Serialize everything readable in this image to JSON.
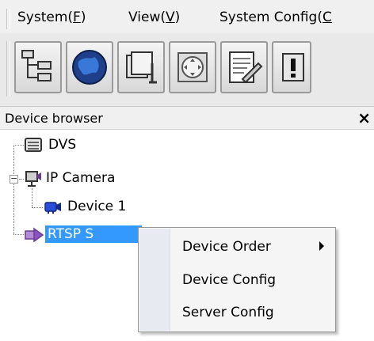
{
  "menubar": {
    "items": [
      {
        "label": "System(",
        "mnemonic": "F",
        "suffix": ")"
      },
      {
        "label": "View(",
        "mnemonic": "V",
        "suffix": ")"
      },
      {
        "label": "System Config(",
        "mnemonic": "C",
        "suffix": ""
      }
    ]
  },
  "toolbar": {
    "buttons": [
      {
        "icon": "device-tree-icon"
      },
      {
        "icon": "globe-icon"
      },
      {
        "icon": "playback-folder-icon"
      },
      {
        "icon": "ptz-control-icon"
      },
      {
        "icon": "log-notepad-icon"
      },
      {
        "icon": "alarm-icon"
      }
    ]
  },
  "device_browser": {
    "title": "Device browser",
    "close_glyph": "×",
    "tree": [
      {
        "label": "DVS",
        "icon": "dvs-icon"
      },
      {
        "label": "IP Camera",
        "icon": "ip-camera-icon",
        "expanded": true,
        "expander": "−"
      },
      {
        "label": "Device 1",
        "icon": "camera-icon"
      },
      {
        "label": "RTSP S",
        "icon": "rtsp-server-icon",
        "selected": true
      }
    ]
  },
  "context_menu": {
    "items": [
      {
        "label": "Device Order",
        "has_submenu": true
      },
      {
        "label": "Device Config"
      },
      {
        "label": "Server Config"
      }
    ]
  },
  "colors": {
    "selection": "#3399ff",
    "menu_background": "#f5f5f5"
  }
}
